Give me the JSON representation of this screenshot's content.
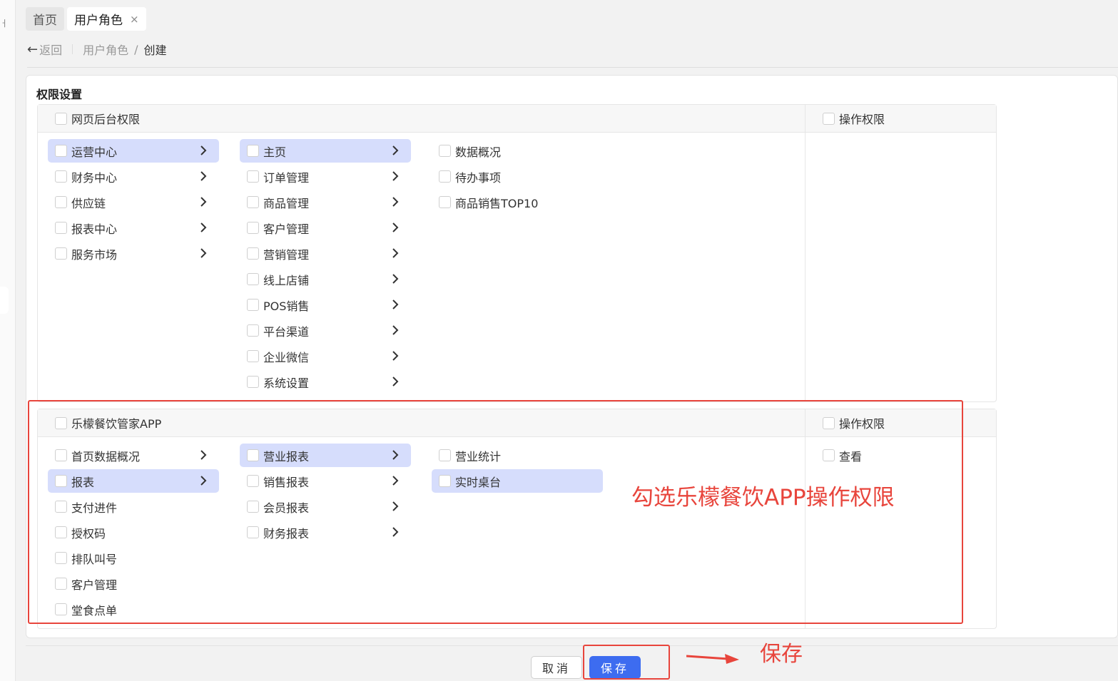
{
  "tabs": [
    {
      "label": "首页"
    },
    {
      "label": "用户角色",
      "close": "×"
    }
  ],
  "breadcrumb": {
    "back": "返回",
    "parent": "用户角色",
    "separator": "/",
    "current": "创建"
  },
  "section_title": "权限设置",
  "web_panel": {
    "header": "网页后台权限",
    "ops_header": "操作权限",
    "col1": [
      "运营中心",
      "财务中心",
      "供应链",
      "报表中心",
      "服务市场"
    ],
    "col2": [
      "主页",
      "订单管理",
      "商品管理",
      "客户管理",
      "营销管理",
      "线上店铺",
      "POS销售",
      "平台渠道",
      "企业微信",
      "系统设置"
    ],
    "col3": [
      "数据概况",
      "待办事项",
      "商品销售TOP10"
    ]
  },
  "app_panel": {
    "header": "乐檬餐饮管家APP",
    "ops_header": "操作权限",
    "col1": [
      "首页数据概况",
      "报表",
      "支付进件",
      "授权码",
      "排队叫号",
      "客户管理",
      "堂食点单"
    ],
    "col2": [
      "营业报表",
      "销售报表",
      "会员报表",
      "财务报表"
    ],
    "col3": [
      "营业统计",
      "实时桌台"
    ],
    "ops": [
      "查看"
    ]
  },
  "annotations": {
    "app_note": "勾选乐檬餐饮APP操作权限",
    "save_note": "保存"
  },
  "buttons": {
    "cancel": "取消",
    "save": "保存"
  },
  "colors": {
    "selected_bg": "#d6ddfc",
    "primary": "#3d6cf0",
    "annotation_red": "#e8453c"
  }
}
